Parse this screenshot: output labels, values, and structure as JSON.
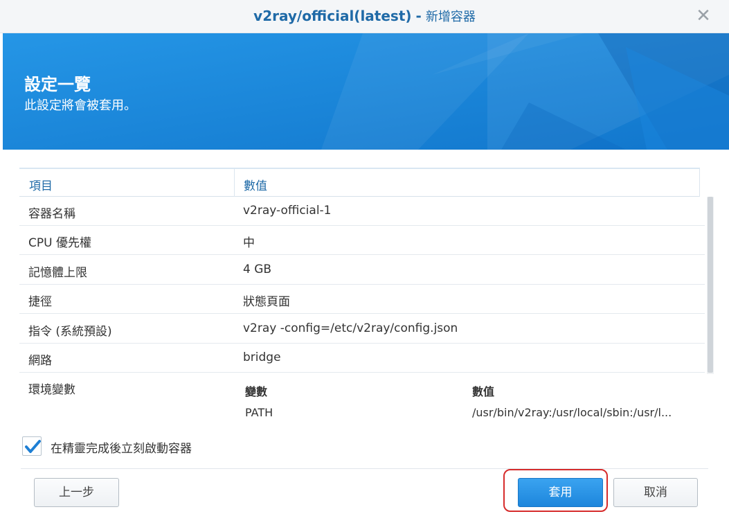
{
  "window": {
    "title_main": "v2ray/official(latest)",
    "title_sep": "-",
    "title_sub": "新增容器",
    "close_glyph": "✕"
  },
  "banner": {
    "title": "設定一覽",
    "subtitle": "此設定將會被套用。"
  },
  "table": {
    "headers": [
      "項目",
      "數值"
    ],
    "rows": [
      {
        "item": "容器名稱",
        "value": "v2ray-official-1"
      },
      {
        "item": "CPU 優先權",
        "value": "中"
      },
      {
        "item": "記憶體上限",
        "value": "4 GB"
      },
      {
        "item": "捷徑",
        "value": "狀態頁面"
      },
      {
        "item": "指令 (系統預設)",
        "value": "v2ray -config=/etc/v2ray/config.json"
      },
      {
        "item": "網路",
        "value": "bridge"
      }
    ],
    "env": {
      "label": "環境變數",
      "headers": [
        "變數",
        "數值"
      ],
      "rows": [
        {
          "name": "PATH",
          "value": "/usr/bin/v2ray:/usr/local/sbin:/usr/l..."
        }
      ]
    }
  },
  "options": {
    "start_after_wizard_label": "在精靈完成後立刻啟動容器",
    "start_after_wizard_checked": true
  },
  "footer": {
    "prev_label": "上一步",
    "apply_label": "套用",
    "cancel_label": "取消"
  },
  "colors": {
    "accent": "#1f6aa7",
    "banner": "#1f8fe0",
    "primary_button": "#2a93e6",
    "highlight": "#d62b2b"
  }
}
